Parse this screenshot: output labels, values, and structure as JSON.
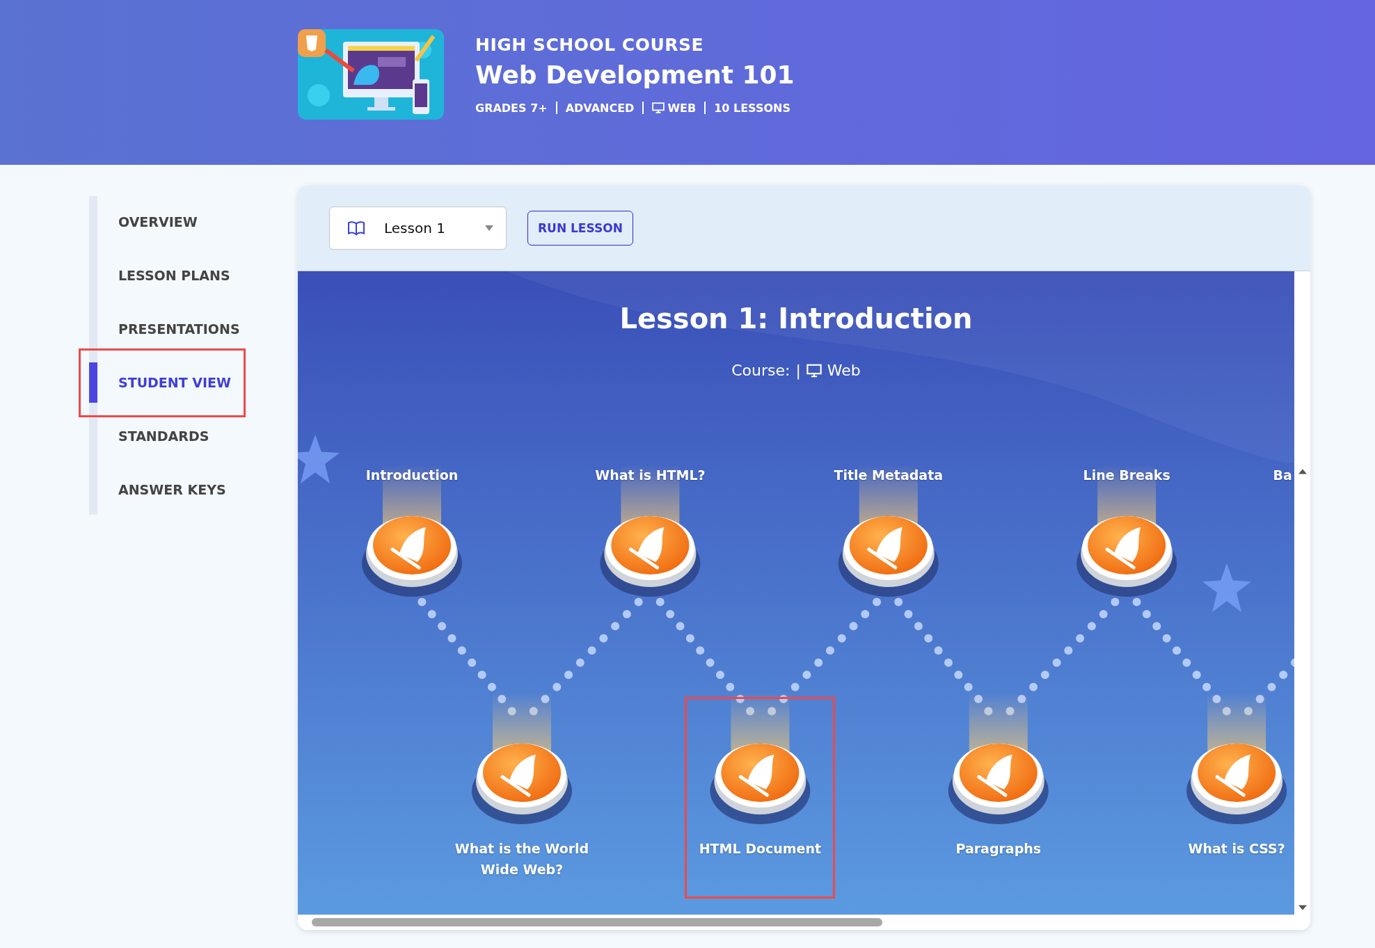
{
  "course": {
    "eyebrow": "HIGH SCHOOL COURSE",
    "title": "Web Development 101",
    "meta": [
      {
        "kind": "text",
        "label": "GRADES 7+"
      },
      {
        "kind": "text",
        "label": "ADVANCED"
      },
      {
        "kind": "web",
        "label": "WEB"
      },
      {
        "kind": "text",
        "label": "10 LESSONS"
      }
    ]
  },
  "sidebar": {
    "items": [
      {
        "label": "OVERVIEW",
        "selected": false
      },
      {
        "label": "LESSON PLANS",
        "selected": false
      },
      {
        "label": "PRESENTATIONS",
        "selected": false
      },
      {
        "label": "STUDENT VIEW",
        "selected": true
      },
      {
        "label": "STANDARDS",
        "selected": false
      },
      {
        "label": "ANSWER KEYS",
        "selected": false
      }
    ]
  },
  "toolbar": {
    "lesson_select": {
      "value": "Lesson 1"
    },
    "run_button": "RUN LESSON"
  },
  "lesson_map": {
    "title": "Lesson 1: Introduction",
    "course_label": "Course:",
    "course_separator": "|",
    "course_value": "Web",
    "top_steps": [
      {
        "label": "Introduction"
      },
      {
        "label": "What is HTML?"
      },
      {
        "label": "Title Metadata"
      },
      {
        "label": "Line Breaks"
      },
      {
        "label": "Ba"
      }
    ],
    "bottom_steps": [
      {
        "label": "What is the World Wide Web?"
      },
      {
        "label": "HTML Document"
      },
      {
        "label": "Paragraphs"
      },
      {
        "label": "What is CSS?"
      }
    ]
  }
}
